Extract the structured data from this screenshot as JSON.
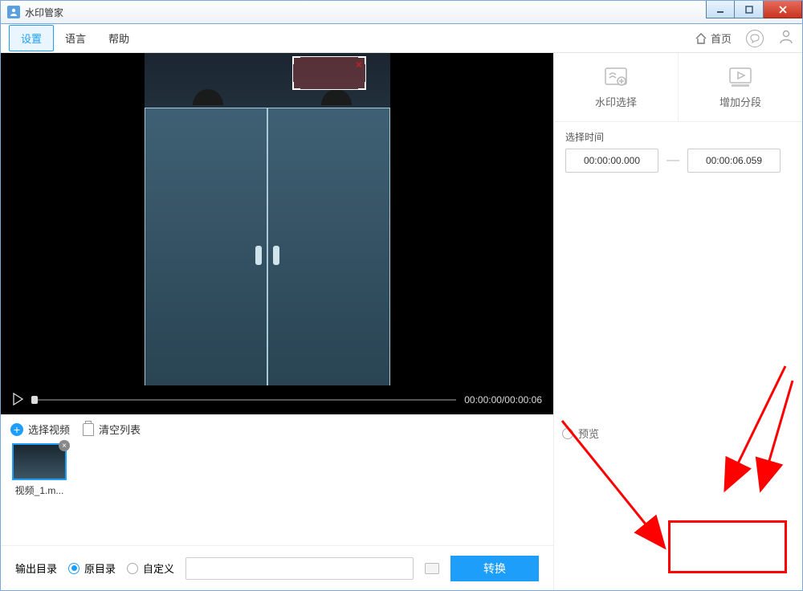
{
  "window": {
    "title": "水印管家"
  },
  "menu": {
    "settings": "设置",
    "language": "语言",
    "help": "帮助",
    "home": "首页"
  },
  "tools": {
    "watermark_select": "水印选择",
    "add_segment": "增加分段"
  },
  "time": {
    "section_label": "选择时间",
    "start": "00:00:00.000",
    "end": "00:00:06.059",
    "separator": "—"
  },
  "playback": {
    "current": "00:00:00",
    "total": "00:00:06"
  },
  "preview": {
    "label": "预览"
  },
  "list": {
    "select_video": "选择视频",
    "clear_list": "清空列表"
  },
  "thumbs": [
    {
      "name": "视频_1.m..."
    }
  ],
  "output": {
    "label": "输出目录",
    "same_dir": "原目录",
    "custom": "自定义",
    "convert": "转换"
  }
}
